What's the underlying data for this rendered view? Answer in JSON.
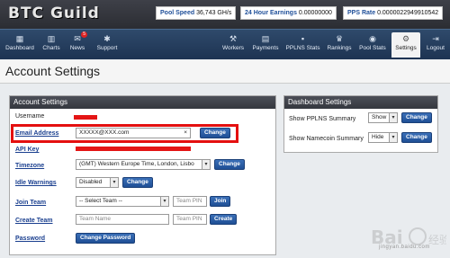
{
  "header": {
    "logo": "BTC Guild",
    "pool_speed_label": "Pool Speed",
    "pool_speed_value": "36,743 GH/s",
    "earnings_label": "24 Hour Earnings",
    "earnings_value": "0.00000000",
    "pps_label": "PPS Rate",
    "pps_value": "0.0000022949910542"
  },
  "nav": {
    "left": [
      {
        "label": "Dashboard",
        "icon": "dashboard-icon"
      },
      {
        "label": "Charts",
        "icon": "chart-icon"
      },
      {
        "label": "News",
        "icon": "news-icon",
        "badge": "5"
      },
      {
        "label": "Support",
        "icon": "support-icon"
      }
    ],
    "right": [
      {
        "label": "Workers",
        "icon": "workers-icon"
      },
      {
        "label": "Payments",
        "icon": "payments-icon"
      },
      {
        "label": "PPLNS Stats",
        "icon": "pplns-icon"
      },
      {
        "label": "Rankings",
        "icon": "trophy-icon"
      },
      {
        "label": "Pool Stats",
        "icon": "pool-icon"
      },
      {
        "label": "Settings",
        "icon": "gear-icon"
      },
      {
        "label": "Logout",
        "icon": "logout-icon"
      }
    ]
  },
  "page_title": "Account Settings",
  "account": {
    "heading": "Account Settings",
    "username_label": "Username",
    "email_label": "Email Address",
    "email_value": "XXXXX@XXX.com",
    "email_clear": "×",
    "change_label": "Change",
    "api_key_label": "API Key",
    "timezone_label": "Timezone",
    "timezone_value": "(GMT) Western Europe Time, London, Lisbo",
    "idle_label": "Idle Warnings",
    "idle_value": "Disabled",
    "join_team_label": "Join Team",
    "team_select": "-- Select Team --",
    "team_pin_placeholder": "Team PIN",
    "join_button": "Join",
    "create_team_label": "Create Team",
    "team_name_placeholder": "Team Name",
    "create_button": "Create",
    "password_label": "Password",
    "change_password_button": "Change Password"
  },
  "dashboard": {
    "heading": "Dashboard Settings",
    "pplns_label": "Show PPLNS Summary",
    "pplns_value": "Show",
    "namecoin_label": "Show Namecoin Summary",
    "namecoin_value": "Hide",
    "change_label": "Change"
  },
  "watermark": "jingyan.baidu.com",
  "colors": {
    "nav_bg": "#1d3352",
    "button": "#1f4f95",
    "redaction": "#e41515",
    "link": "#1a3f8f"
  }
}
